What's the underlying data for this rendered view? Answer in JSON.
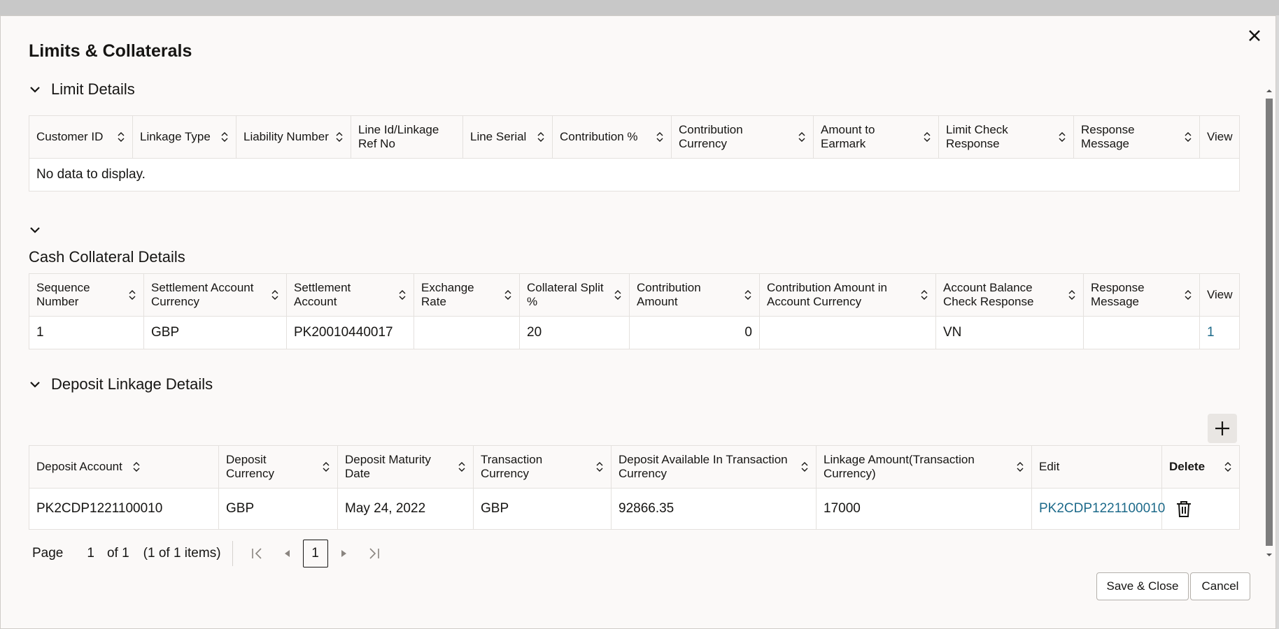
{
  "dialog": {
    "title": "Limits & Collaterals"
  },
  "limit_section": {
    "title": "Limit Details",
    "columns": [
      "Customer ID",
      "Linkage Type",
      "Liability Number",
      "Line Id/Linkage Ref No",
      "Line Serial",
      "Contribution %",
      "Contribution Currency",
      "Amount to Earmark",
      "Limit Check Response",
      "Response Message",
      "View"
    ],
    "empty_text": "No data to display."
  },
  "cash_section": {
    "title": "Cash Collateral Details",
    "columns": [
      "Sequence Number",
      "Settlement Account Currency",
      "Settlement Account",
      "Exchange Rate",
      "Collateral Split %",
      "Contribution Amount",
      "Contribution Amount in Account Currency",
      "Account Balance Check Response",
      "Response Message",
      "View"
    ],
    "row": {
      "seq": "1",
      "currency": "GBP",
      "account": "PK20010440017",
      "rate": "",
      "split": "20",
      "amount": "0",
      "amount_acc": "",
      "balance_resp": "VN",
      "resp_msg": "",
      "view": "1"
    }
  },
  "deposit_section": {
    "title": "Deposit Linkage Details",
    "columns": [
      "Deposit Account",
      "Deposit Currency",
      "Deposit Maturity Date",
      "Transaction Currency",
      "Deposit Available In Transaction Currency",
      "Linkage Amount(Transaction Currency)",
      "Edit",
      "Delete"
    ],
    "row": {
      "account": "PK2CDP1221100010",
      "currency": "GBP",
      "maturity": "May 24, 2022",
      "txn_currency": "GBP",
      "available": "92866.35",
      "linkage": "17000",
      "edit": "PK2CDP1221100010"
    }
  },
  "pager": {
    "page_label": "Page",
    "page": "1",
    "of": "of 1",
    "items": "(1 of 1 items)",
    "current": "1"
  },
  "buttons": {
    "save_close": "Save & Close",
    "cancel": "Cancel"
  }
}
